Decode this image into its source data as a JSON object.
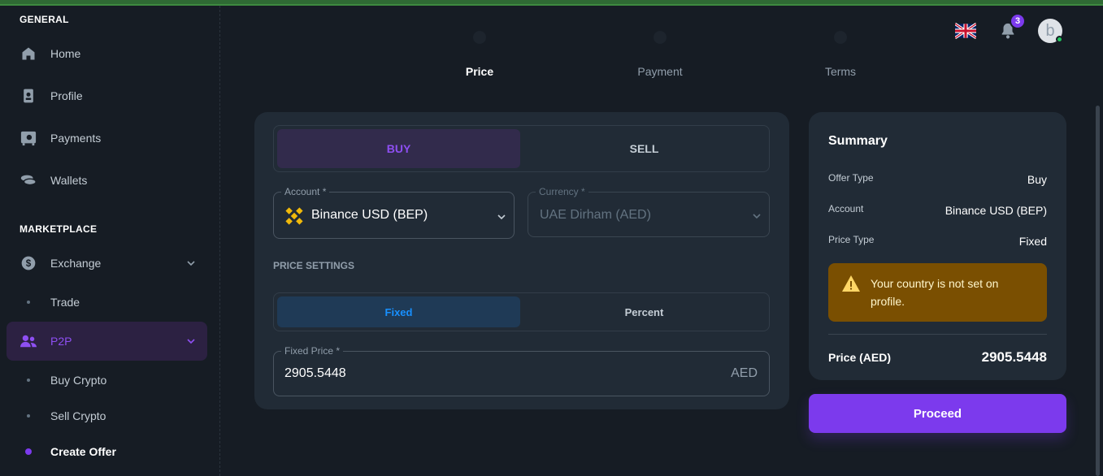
{
  "sidebar": {
    "general_header": "GENERAL",
    "marketplace_header": "MARKETPLACE",
    "items": {
      "home": "Home",
      "profile": "Profile",
      "payments": "Payments",
      "wallets": "Wallets",
      "exchange": "Exchange",
      "trade": "Trade",
      "p2p": "P2P",
      "buy_crypto": "Buy Crypto",
      "sell_crypto": "Sell Crypto",
      "create_offer": "Create Offer"
    }
  },
  "header": {
    "notification_count": "3",
    "avatar_initial": "b"
  },
  "stepper": {
    "steps": [
      "Price",
      "Payment",
      "Terms"
    ],
    "active_step": "Price"
  },
  "form": {
    "type_buy": "BUY",
    "type_sell": "SELL",
    "account_label": "Account *",
    "account_value": "Binance USD (BEP)",
    "currency_label": "Currency *",
    "currency_value": "UAE Dirham (AED)",
    "price_settings_title": "PRICE SETTINGS",
    "price_fixed": "Fixed",
    "price_percent": "Percent",
    "fixed_price_label": "Fixed Price *",
    "fixed_price_value": "2905.5448",
    "fixed_price_suffix": "AED"
  },
  "summary": {
    "title": "Summary",
    "offer_type_label": "Offer Type",
    "offer_type_value": "Buy",
    "account_label": "Account",
    "account_value": "Binance USD (BEP)",
    "price_type_label": "Price Type",
    "price_type_value": "Fixed",
    "warning": "Your country is not set on profile.",
    "price_label": "Price (AED)",
    "price_value": "2905.5448"
  },
  "proceed_label": "Proceed",
  "colors": {
    "accent": "#7c3aed",
    "background": "#161c24",
    "card": "#212b36",
    "warning_bg": "#7a4f01",
    "binance": "#f0b90b"
  }
}
